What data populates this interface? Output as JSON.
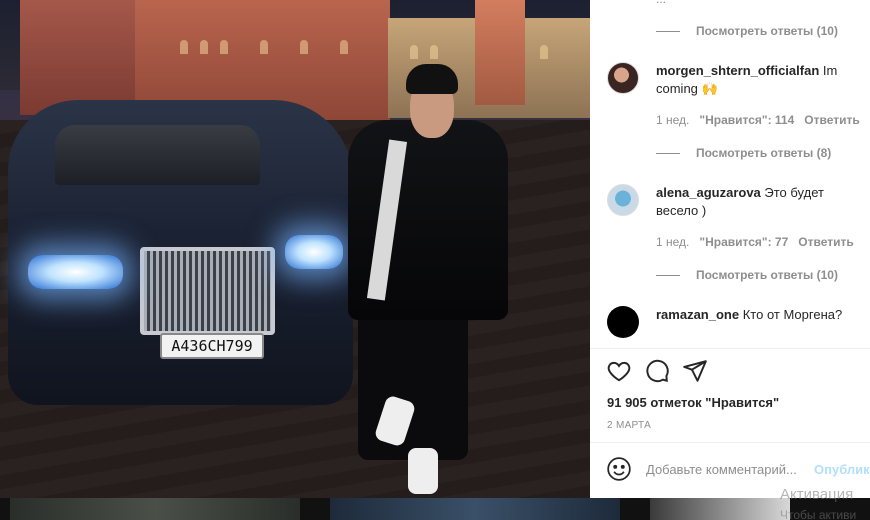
{
  "photo": {
    "license_plate": "А436СН799"
  },
  "comments": {
    "cut_text": "...",
    "items": [
      {
        "view_replies": "Посмотреть ответы (10)"
      },
      {
        "username": "morgen_shtern_officialfan",
        "text": "Im coming 🙌",
        "time": "1 нед.",
        "likes": "\"Нравится\": 114",
        "reply": "Ответить",
        "view_replies": "Посмотреть ответы (8)"
      },
      {
        "username": "alena_aguzarova",
        "text": "Это будет весело )",
        "time": "1 нед.",
        "likes": "\"Нравится\": 77",
        "reply": "Ответить",
        "view_replies": "Посмотреть ответы (10)"
      },
      {
        "username": "ramazan_one",
        "text": "Кто от Моргена?"
      }
    ]
  },
  "actions": {
    "like_icon": "heart-icon",
    "comment_icon": "comment-bubble-icon",
    "share_icon": "paper-plane-icon"
  },
  "post": {
    "likes_label": "91 905 отметок \"Нравится\"",
    "date": "2 МАРТА"
  },
  "add_comment": {
    "placeholder": "Добавьте комментарий...",
    "post_label": "Опубликовать",
    "emoji_icon": "smiley-icon"
  },
  "overlay": {
    "watermark_line1": "Активация",
    "watermark_line2": "Чтобы активи"
  },
  "colors": {
    "primary_text": "#262626",
    "secondary_text": "#8e8e8e",
    "post_button_disabled": "#b2dffc",
    "panel_bg": "#ffffff"
  }
}
